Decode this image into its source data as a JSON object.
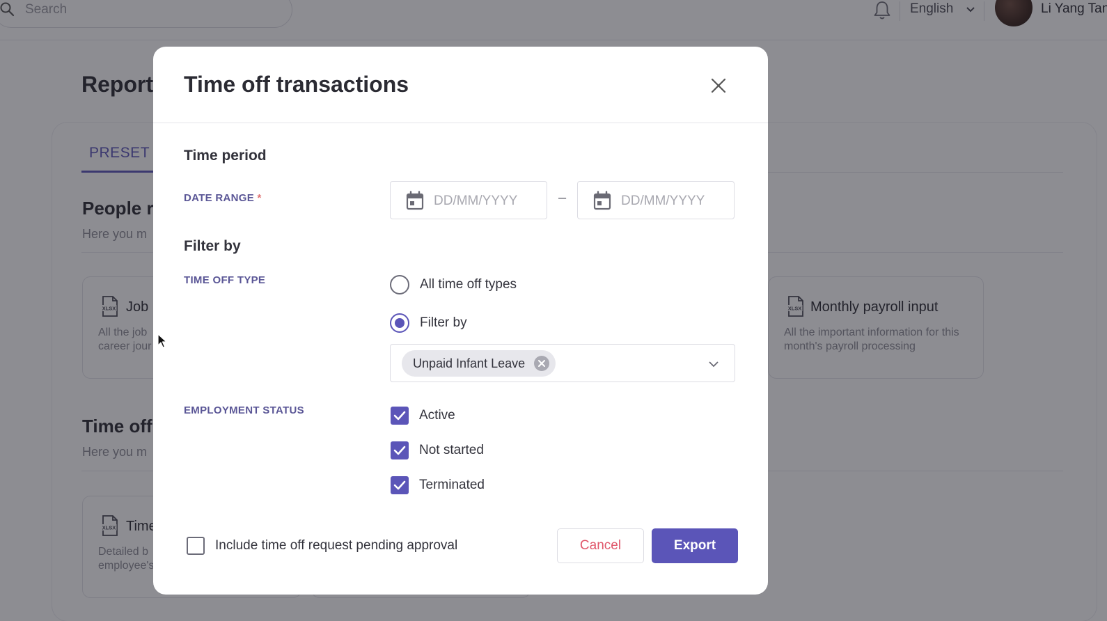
{
  "topbar": {
    "search_placeholder": "Search",
    "language": "English",
    "user_name": "Li Yang Tan"
  },
  "background": {
    "page_title": "Report",
    "tab_preset": "PRESET",
    "people_section": {
      "title": "People r",
      "subtitle": "Here you m",
      "cards": [
        {
          "title": "Job h",
          "desc": "All the job\ncareer jour",
          "icon": "xlsx-file-icon"
        },
        {
          "title": "Monthly payroll input",
          "desc": "All the important information for this month's payroll processing",
          "icon": "xlsx-file-icon"
        }
      ]
    },
    "timeoff_section": {
      "title": "Time off",
      "subtitle": "Here you m",
      "cards": [
        {
          "title": "Time",
          "desc": "Detailed b\nemployee's",
          "icon": "xlsx-file-icon"
        }
      ]
    }
  },
  "modal": {
    "title": "Time off transactions",
    "time_period": {
      "heading": "Time period",
      "date_range_label": "DATE RANGE",
      "required_mark": "*",
      "start_placeholder": "DD/MM/YYYY",
      "separator": "–",
      "end_placeholder": "DD/MM/YYYY"
    },
    "filter": {
      "heading": "Filter by",
      "time_off_type_label": "TIME OFF TYPE",
      "options": [
        {
          "label": "All time off types",
          "selected": false
        },
        {
          "label": "Filter by",
          "selected": true
        }
      ],
      "selected_chips": [
        "Unpaid Infant Leave"
      ],
      "employment_status_label": "EMPLOYMENT STATUS",
      "statuses": [
        {
          "label": "Active",
          "checked": true
        },
        {
          "label": "Not started",
          "checked": true
        },
        {
          "label": "Terminated",
          "checked": true
        }
      ]
    },
    "footer": {
      "include_pending_label": "Include time off request pending approval",
      "include_pending_checked": false,
      "cancel_label": "Cancel",
      "export_label": "Export"
    }
  },
  "colors": {
    "accent": "#5b55b8",
    "cancel_text": "#e0566a",
    "label": "#5a5696"
  }
}
